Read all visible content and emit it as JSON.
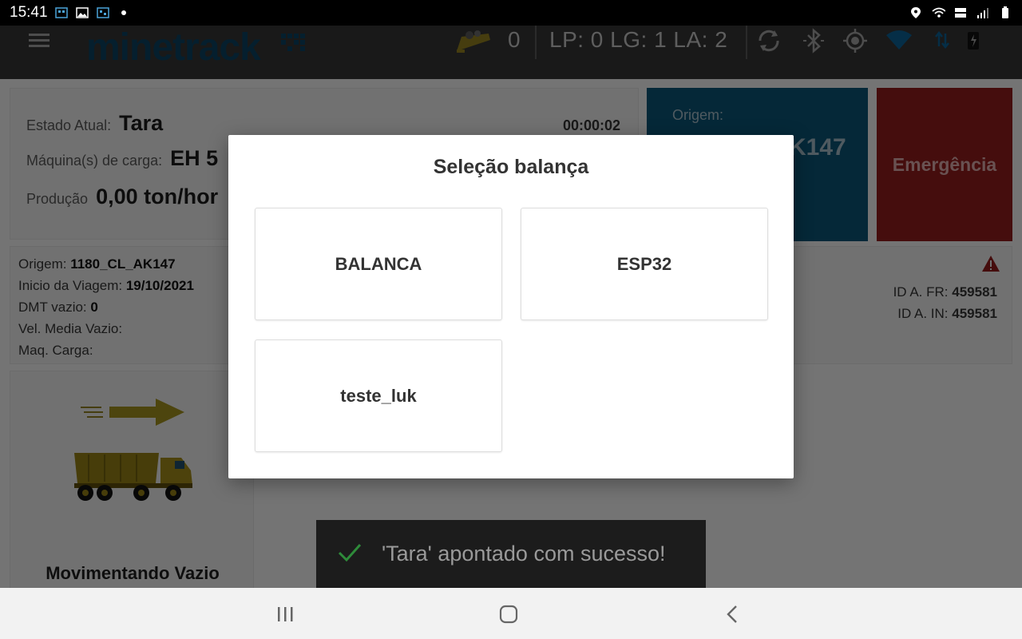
{
  "statusbar": {
    "time": "15:41"
  },
  "header": {
    "logo": "minetrack",
    "load_count": "0",
    "counts_text": "LP: 0 LG: 1 LA: 2"
  },
  "status": {
    "state_label": "Estado Atual:",
    "state_value": "Tara",
    "timer": "00:00:02",
    "machine_label": "Máquina(s) de carga:",
    "machine_value": "EH 5",
    "production_label": "Produção",
    "production_value": "0,00 ton/hor"
  },
  "origin_tile": {
    "label": "Origem:",
    "value": "K147"
  },
  "emergency_label": "Emergência",
  "info": {
    "origin_label": "Origem:",
    "origin_value": "1180_CL_AK147",
    "trip_start_label": "Inicio da Viagem:",
    "trip_start_value": "19/10/2021",
    "dmt_label": "DMT vazio:",
    "dmt_value": "0",
    "speed_label": "Vel. Media Vazio:",
    "maq_label": "Maq. Carga:",
    "id_fr_label": "ID A. FR:",
    "id_fr_value": "459581",
    "id_in_label": "ID A. IN:",
    "id_in_value": "459581"
  },
  "movement_label": "Movimentando Vazio",
  "dialog": {
    "title": "Seleção balança",
    "options": [
      "BALANCA",
      "ESP32",
      "teste_luk"
    ]
  },
  "toast": {
    "text": "'Tara' apontado com sucesso!"
  },
  "colors": {
    "appbar": "#333333",
    "origin_tile": "#0a5170",
    "emergency_tile": "#8a1a1a",
    "toast_check": "#2e8b3a"
  }
}
